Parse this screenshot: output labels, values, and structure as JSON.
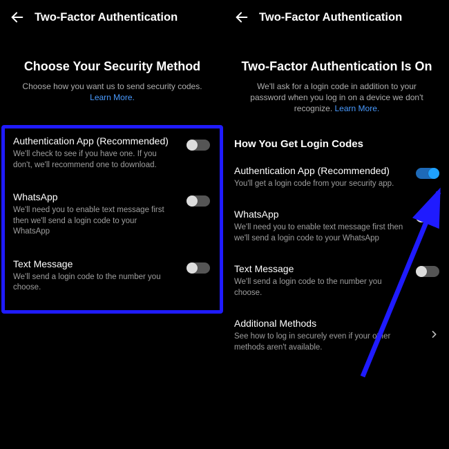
{
  "left": {
    "header": {
      "title": "Two-Factor Authentication"
    },
    "section": {
      "title": "Choose Your Security Method",
      "subtitle": "Choose how you want us to send security codes.",
      "learn_more": "Learn More."
    },
    "options": [
      {
        "title": "Authentication App (Recommended)",
        "subtitle": "We'll check to see if you have one. If you don't, we'll recommend one to download."
      },
      {
        "title": "WhatsApp",
        "subtitle": "We'll need you to enable text message first then we'll send a login code to your WhatsApp"
      },
      {
        "title": "Text Message",
        "subtitle": "We'll send a login code to the number you choose."
      }
    ]
  },
  "right": {
    "header": {
      "title": "Two-Factor Authentication"
    },
    "section": {
      "title": "Two-Factor Authentication Is On",
      "subtitle": "We'll ask for a login code in addition to your password when you log in on a device we don't recognize.",
      "learn_more": "Learn More."
    },
    "codes_heading": "How You Get Login Codes",
    "options": [
      {
        "title": "Authentication App (Recommended)",
        "subtitle": "You'll get a login code from your security app."
      },
      {
        "title": "WhatsApp",
        "subtitle": "We'll need you to enable text message first then we'll send a login code to your WhatsApp"
      },
      {
        "title": "Text Message",
        "subtitle": "We'll send a login code to the number you choose."
      },
      {
        "title": "Additional Methods",
        "subtitle": "See how to log in securely even if your other methods aren't available."
      }
    ]
  }
}
